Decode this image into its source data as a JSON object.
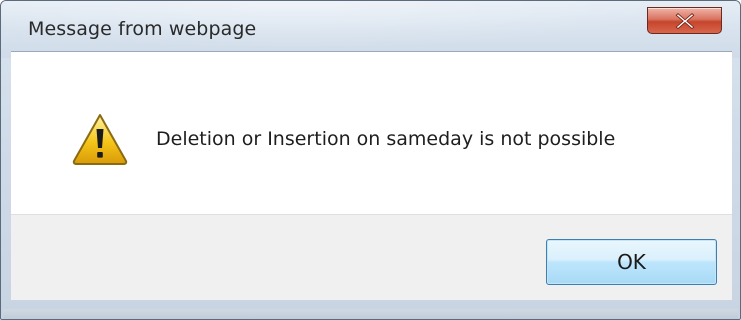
{
  "window": {
    "title": "Message from webpage",
    "close_icon": "close-icon",
    "close_button_color": "#c5452c"
  },
  "message": {
    "icon": "warning-icon",
    "text": "Deletion or Insertion on sameday is not possible"
  },
  "buttons": {
    "ok_label": "OK"
  },
  "colors": {
    "titlebar": "#d7e2ee",
    "content_bg": "#ffffff",
    "footer_bg": "#f0f0f0",
    "ok_button_border": "#3c7fb1",
    "warning_fill": "#f5c518"
  }
}
